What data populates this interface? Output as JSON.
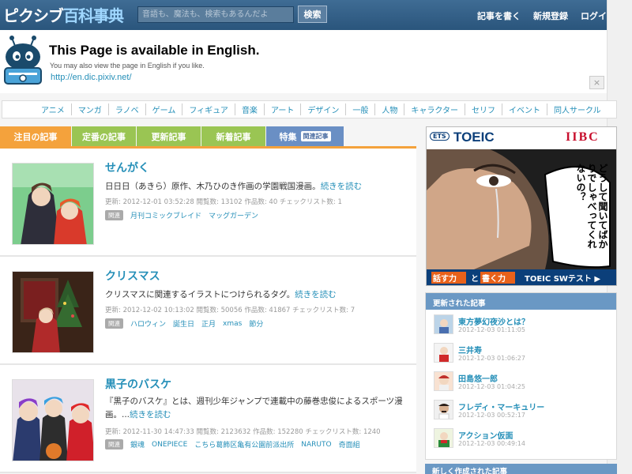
{
  "header": {
    "logo_main": "ピクシブ",
    "logo_accent": "百科事典",
    "search_placeholder": "音語も、魔法も、検索もあるんだよ",
    "search_button": "検索",
    "nav": [
      "記事を書く",
      "新規登録",
      "ログイ"
    ]
  },
  "english_banner": {
    "title": "This Page is available in English.",
    "subtitle": "You may also view the page in English if you like.",
    "link": "http://en.dic.pixiv.net/",
    "close": "×"
  },
  "categories": [
    "アニメ",
    "マンガ",
    "ラノベ",
    "ゲーム",
    "フィギュア",
    "音楽",
    "アート",
    "デザイン",
    "一般",
    "人物",
    "キャラクター",
    "セリフ",
    "イベント",
    "同人サークル"
  ],
  "tabs": [
    {
      "label": "注目の記事",
      "color": "#f4a23c",
      "badge": ""
    },
    {
      "label": "定番の記事",
      "color": "#9ac553",
      "badge": ""
    },
    {
      "label": "更新記事",
      "color": "#9ac553",
      "badge": ""
    },
    {
      "label": "新着記事",
      "color": "#9ac553",
      "badge": ""
    },
    {
      "label": "特集",
      "color": "#6a8fc4",
      "badge": "関連記事"
    }
  ],
  "articles": [
    {
      "title": "せんがく",
      "desc": "日日日（あきら）原作、木乃ひのき作画の学園戦国漫画。",
      "more": "続きを読む",
      "meta": "更新: 2012-12-01 03:52:28  閲覧数: 13102  作品数: 40  チェックリスト数: 1",
      "related_label": "関連",
      "tags": [
        "月刊コミックブレイド",
        "マッグガーデン"
      ]
    },
    {
      "title": "クリスマス",
      "desc": "クリスマスに関連するイラストにつけられるタグ。",
      "more": "続きを読む",
      "meta": "更新: 2012-12-02 10:13:02  閲覧数: 50056  作品数: 41867  チェックリスト数: 7",
      "related_label": "関連",
      "tags": [
        "ハロウィン",
        "誕生日",
        "正月",
        "xmas",
        "節分"
      ]
    },
    {
      "title": "黒子のバスケ",
      "desc": "『黒子のバスケ』とは、週刊少年ジャンプで連載中の藤巻忠俊によるスポーツ漫画。...",
      "more": "続きを読む",
      "meta": "更新: 2012-11-30 14:47:33  閲覧数: 2123632  作品数: 152280  チェックリスト数: 1240",
      "related_label": "関連",
      "tags": [
        "銀魂",
        "ONEPIECE",
        "こちら葛飾区亀有公園前派出所",
        "NARUTO",
        "奇面組"
      ]
    }
  ],
  "ad": {
    "ets": "ETS",
    "toeic": "TOEIC",
    "iibc": "IIBC",
    "speech": "どうして聞いてばかりでしゃべってくれないの？",
    "speak": "話す力",
    "to": "と",
    "write": "書く力",
    "test": "TOEIC SWテスト ▶"
  },
  "recent": {
    "heading": "更新された記事",
    "items": [
      {
        "title": "東方夢幻夜沙とは？",
        "time": "2012-12-03 01:11:05"
      },
      {
        "title": "三井寿",
        "time": "2012-12-03 01:06:27"
      },
      {
        "title": "田島悠一郎",
        "time": "2012-12-03 01:04:25"
      },
      {
        "title": "フレディ・マーキュリー",
        "time": "2012-12-03 00:52:17"
      },
      {
        "title": "アクション仮面",
        "time": "2012-12-03 00:49:14"
      }
    ]
  },
  "new_heading": "新しく作成された記事"
}
